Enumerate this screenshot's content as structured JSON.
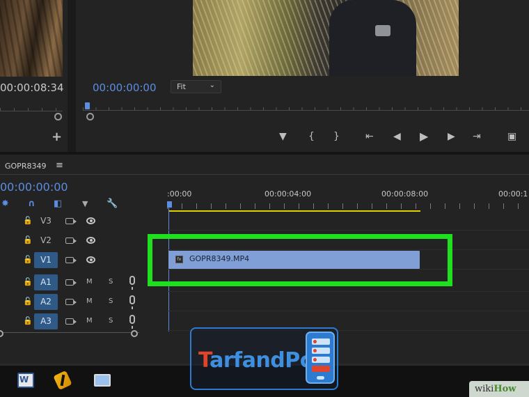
{
  "source_monitor": {
    "timecode": "00:00:08:34",
    "add_icon": "plus-icon"
  },
  "program_monitor": {
    "timecode": "00:00:00:00",
    "zoom": "Fit",
    "transport": [
      "add-marker-icon",
      "mark-in-icon",
      "mark-out-icon",
      "go-to-in-icon",
      "step-back-icon",
      "play-icon",
      "step-forward-icon",
      "go-to-out-icon",
      "insert-icon"
    ]
  },
  "timeline": {
    "sequence_name": "GOPR8349",
    "menu_icon": "hamburger-icon",
    "timecode": "00:00:00:00",
    "ruler_labels": [
      ":00:00",
      "00:00:04:00",
      "00:00:08:00",
      "00:00:1"
    ],
    "work_area_color": "#e0d100",
    "tracks": [
      {
        "id": "V3",
        "type": "video",
        "active": false
      },
      {
        "id": "V2",
        "type": "video",
        "active": false
      },
      {
        "id": "V1",
        "type": "video",
        "active": true
      },
      {
        "id": "A1",
        "type": "audio",
        "active": true,
        "mute": "M",
        "solo": "S"
      },
      {
        "id": "A2",
        "type": "audio",
        "active": true,
        "mute": "M",
        "solo": "S"
      },
      {
        "id": "A3",
        "type": "audio",
        "active": true,
        "mute": "M",
        "solo": "S"
      }
    ],
    "clip": {
      "name": "GOPR8349.MP4",
      "track": "V1",
      "color": "#7f9fd6"
    }
  },
  "highlight_color": "#1ee01f",
  "taskbar": {
    "apps": [
      "word-icon",
      "app-icon",
      "image-viewer-icon"
    ],
    "word_letter": "W"
  },
  "watermarks": {
    "tarfandpc_t": "T",
    "tarfandpc_rest": "arfandPc",
    "wikihow_wiki": "wiki",
    "wikihow_how": "How"
  }
}
